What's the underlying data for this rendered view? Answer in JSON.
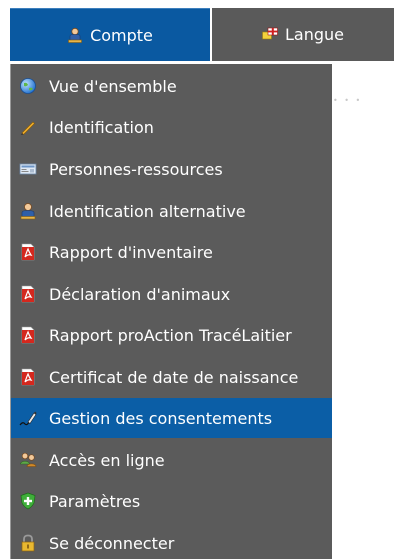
{
  "tabs": {
    "compte": {
      "label": "Compte",
      "icon": "user-icon"
    },
    "langue": {
      "label": "Langue",
      "icon": "flag-icon"
    }
  },
  "menu": {
    "items": [
      {
        "label": "Vue d'ensemble",
        "icon": "globe-icon"
      },
      {
        "label": "Identification",
        "icon": "pencil-icon"
      },
      {
        "label": "Personnes-ressources",
        "icon": "address-card-icon"
      },
      {
        "label": "Identification alternative",
        "icon": "user-icon"
      },
      {
        "label": "Rapport d'inventaire",
        "icon": "pdf-icon"
      },
      {
        "label": "Déclaration d'animaux",
        "icon": "pdf-icon"
      },
      {
        "label": "Rapport proAction TracéLaitier",
        "icon": "pdf-icon"
      },
      {
        "label": "Certificat de date de naissance",
        "icon": "pdf-icon"
      },
      {
        "label": "Gestion des consentements",
        "icon": "signature-pen-icon",
        "active": true
      },
      {
        "label": "Accès en ligne",
        "icon": "users-icon"
      },
      {
        "label": "Paramètres",
        "icon": "shield-plus-icon"
      },
      {
        "label": "Se déconnecter",
        "icon": "padlock-icon"
      }
    ]
  },
  "colors": {
    "active_tab": "#0a59a1",
    "inactive_tab": "#5a5a5a",
    "menu_bg": "#5b5b5b",
    "active_item": "#0b5ea6"
  }
}
